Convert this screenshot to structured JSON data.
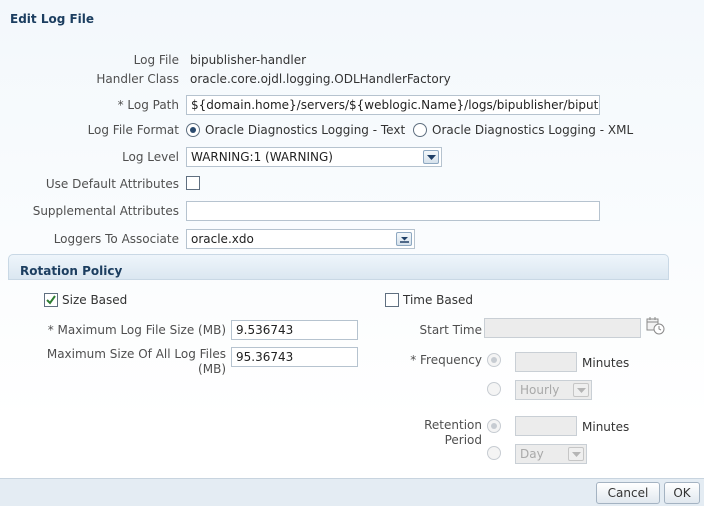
{
  "dialog": {
    "title": "Edit Log File"
  },
  "form": {
    "log_file_label": "Log File",
    "log_file_value": "bipublisher-handler",
    "handler_class_label": "Handler Class",
    "handler_class_value": "oracle.core.ojdl.logging.ODLHandlerFactory",
    "log_path_label": "* Log Path",
    "log_path_value": "${domain.home}/servers/${weblogic.Name}/logs/bipublisher/biput",
    "log_file_format_label": "Log File Format",
    "format_options": [
      "Oracle Diagnostics Logging - Text",
      "Oracle Diagnostics Logging - XML"
    ],
    "format_selected": "Oracle Diagnostics Logging - Text",
    "log_level_label": "Log Level",
    "log_level_value": "WARNING:1 (WARNING)",
    "use_default_attributes_label": "Use Default Attributes",
    "use_default_attributes_checked": false,
    "supplemental_attributes_label": "Supplemental Attributes",
    "supplemental_attributes_value": "",
    "loggers_label": "Loggers To Associate",
    "loggers_value": "oracle.xdo"
  },
  "rotation": {
    "section_title": "Rotation Policy",
    "size_based_label": "Size Based",
    "size_based_checked": true,
    "max_log_file_size_label": "* Maximum Log File Size (MB)",
    "max_log_file_size_value": "9.536743",
    "max_all_files_label_line1": "Maximum Size Of All Log Files",
    "max_all_files_label_line2": "(MB)",
    "max_all_files_value": "95.36743",
    "time_based_label": "Time Based",
    "time_based_checked": false,
    "start_time_label": "Start Time",
    "start_time_value": "",
    "frequency_label": "* Frequency",
    "frequency_minutes_value": "",
    "frequency_minutes_unit": "Minutes",
    "frequency_select_value": "Hourly",
    "retention_label_line1": "Retention",
    "retention_label_line2": "Period",
    "retention_minutes_value": "",
    "retention_minutes_unit": "Minutes",
    "retention_select_value": "Day"
  },
  "footer": {
    "cancel_label": "Cancel",
    "ok_label": "OK"
  },
  "colors": {
    "title": "#1c3e60",
    "footer_bg": "#e4ecf3",
    "checkmark": "#2e7d32"
  }
}
